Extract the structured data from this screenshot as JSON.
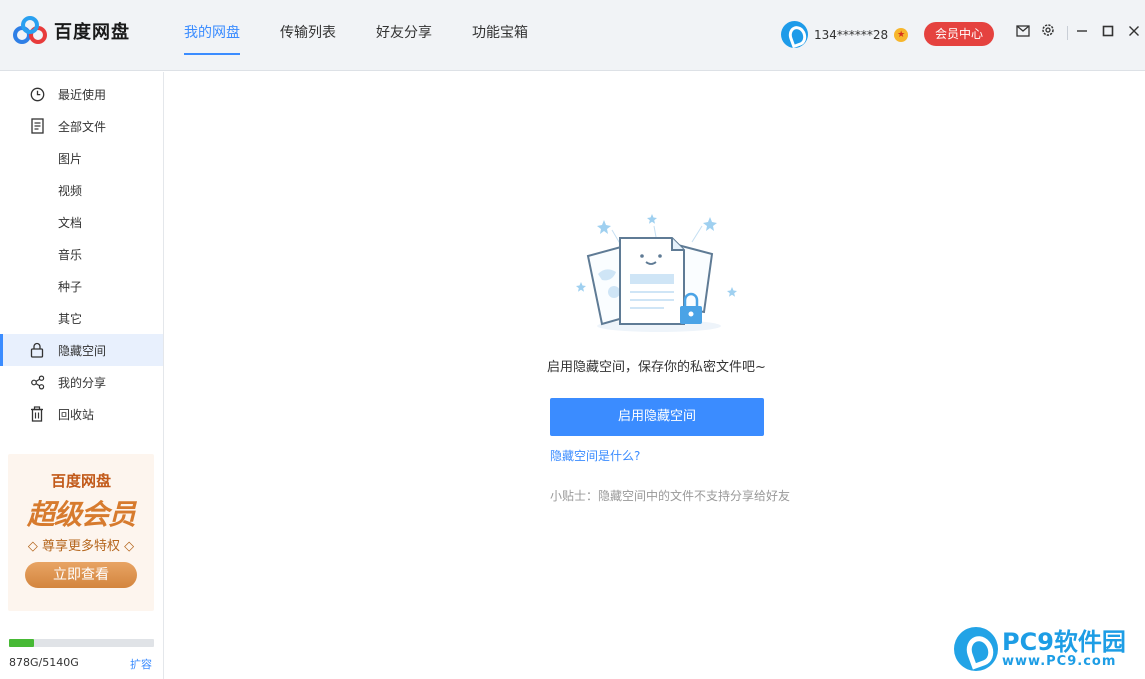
{
  "app": {
    "logo_text": "百度网盘"
  },
  "nav": {
    "tabs": [
      {
        "label": "我的网盘",
        "active": true
      },
      {
        "label": "传输列表",
        "active": false
      },
      {
        "label": "好友分享",
        "active": false
      },
      {
        "label": "功能宝箱",
        "active": false
      }
    ]
  },
  "user": {
    "name": "134******28",
    "vip_button": "会员中心"
  },
  "icons": {
    "mail": "mail-icon",
    "settings": "gear-icon",
    "minimize": "minimize-icon",
    "maximize": "maximize-icon",
    "close": "close-icon"
  },
  "sidebar": {
    "items": [
      {
        "label": "最近使用",
        "icon": "clock-icon"
      },
      {
        "label": "全部文件",
        "icon": "document-icon"
      },
      {
        "label": "图片",
        "icon": ""
      },
      {
        "label": "视频",
        "icon": ""
      },
      {
        "label": "文档",
        "icon": ""
      },
      {
        "label": "音乐",
        "icon": ""
      },
      {
        "label": "种子",
        "icon": ""
      },
      {
        "label": "其它",
        "icon": ""
      },
      {
        "label": "隐藏空间",
        "icon": "lock-icon",
        "active": true
      },
      {
        "label": "我的分享",
        "icon": "share-icon"
      },
      {
        "label": "回收站",
        "icon": "trash-icon"
      }
    ],
    "promo": {
      "title": "百度网盘",
      "big": "超级会员",
      "subtitle": "◇ 尊享更多特权 ◇",
      "button": "立即查看"
    },
    "storage": {
      "used_text": "878G/5140G",
      "used_fraction": 0.171,
      "expand_label": "扩容"
    }
  },
  "main": {
    "headline": "启用隐藏空间，保存你的私密文件吧~",
    "primary_button": "启用隐藏空间",
    "what_link": "隐藏空间是什么?",
    "tip": "小贴士：隐藏空间中的文件不支持分享给好友"
  },
  "watermark": {
    "big": "PC9软件园",
    "small": "www.PC9.com"
  },
  "colors": {
    "accent": "#3b8cff",
    "vip": "#e5423f",
    "storage": "#47b935"
  }
}
